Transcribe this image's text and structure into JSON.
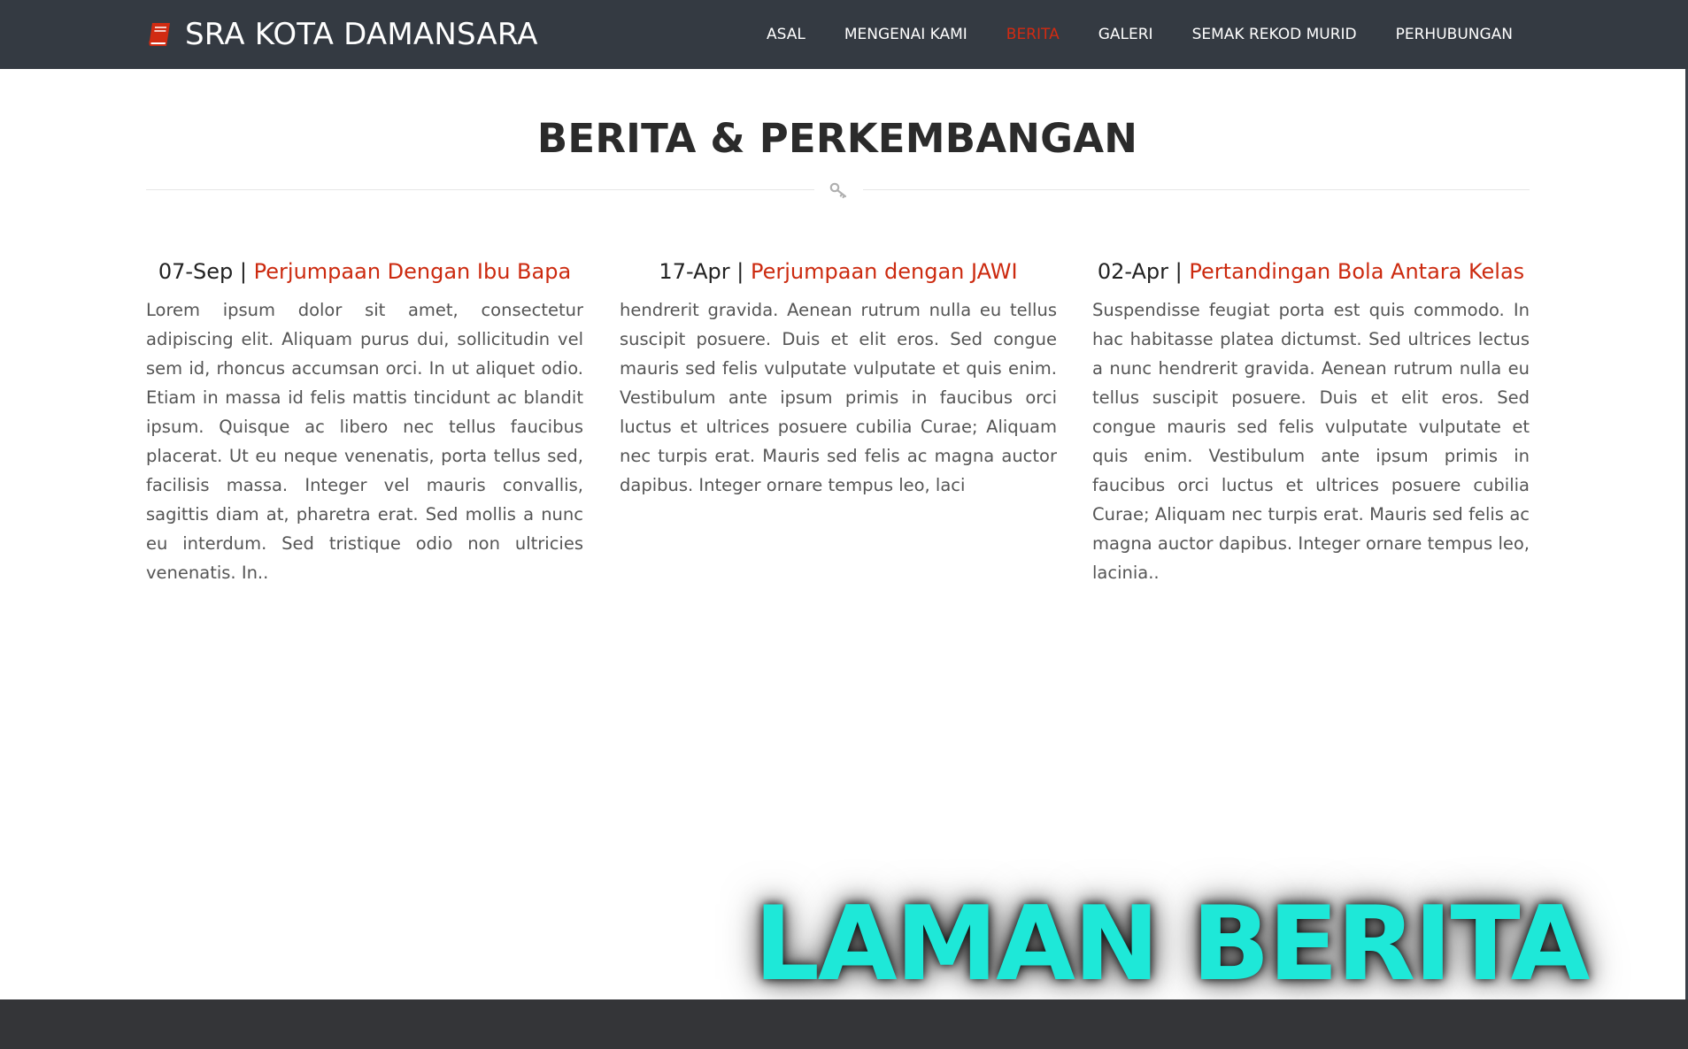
{
  "brand": {
    "icon": "book-icon",
    "name": "SRA KOTA DAMANSARA",
    "icon_color": "#d12b12"
  },
  "nav": {
    "items": [
      {
        "label": "ASAL",
        "active": false
      },
      {
        "label": "MENGENAI KAMI",
        "active": false
      },
      {
        "label": "BERITA",
        "active": true
      },
      {
        "label": "GALERI",
        "active": false
      },
      {
        "label": "SEMAK REKOD MURID",
        "active": false
      },
      {
        "label": "PERHUBUNGAN",
        "active": false
      }
    ],
    "active_color": "#d12b12"
  },
  "section": {
    "title": "BERITA & PERKEMBANGAN",
    "divider_icon": "key-icon"
  },
  "news": [
    {
      "date": "07-Sep",
      "separator": "|",
      "title": "Perjumpaan Dengan Ibu Bapa",
      "body": "Lorem ipsum dolor sit amet, consectetur adipiscing elit. Aliquam purus dui, sollicitudin vel sem id, rhoncus accumsan orci. In ut aliquet odio. Etiam in massa id felis mattis tincidunt ac blandit ipsum. Quisque ac libero nec tellus faucibus placerat. Ut eu neque venenatis, porta tellus sed, facilisis massa. Integer vel mauris convallis, sagittis diam at, pharetra erat. Sed mollis a nunc eu interdum. Sed tristique odio non ultricies venenatis. In.."
    },
    {
      "date": "17-Apr",
      "separator": "|",
      "title": "Perjumpaan dengan JAWI",
      "body": "hendrerit gravida. Aenean rutrum nulla eu tellus suscipit posuere. Duis et elit eros. Sed congue mauris sed felis vulputate vulputate et quis enim. Vestibulum ante ipsum primis in faucibus orci luctus et ultrices posuere cubilia Curae; Aliquam nec turpis erat. Mauris sed felis ac magna auctor dapibus. Integer ornare tempus leo, laci"
    },
    {
      "date": "02-Apr",
      "separator": "|",
      "title": "Pertandingan Bola Antara Kelas",
      "body": "Suspendisse feugiat porta est quis commodo. In hac habitasse platea dictumst. Sed ultrices lectus a nunc hendrerit gravida. Aenean rutrum nulla eu tellus suscipit posuere. Duis et elit eros. Sed congue mauris sed felis vulputate vulputate et quis enim. Vestibulum ante ipsum primis in faucibus orci luctus et ultrices posuere cubilia Curae; Aliquam nec turpis erat. Mauris sed felis ac magna auctor dapibus. Integer ornare tempus leo, lacinia.."
    }
  ],
  "overlay": {
    "text": "LAMAN BERITA",
    "color": "#1ee8d8"
  },
  "colors": {
    "navbar_bg": "#343a42",
    "title_link": "#cc2a0f",
    "footer_bg": "#343538"
  }
}
